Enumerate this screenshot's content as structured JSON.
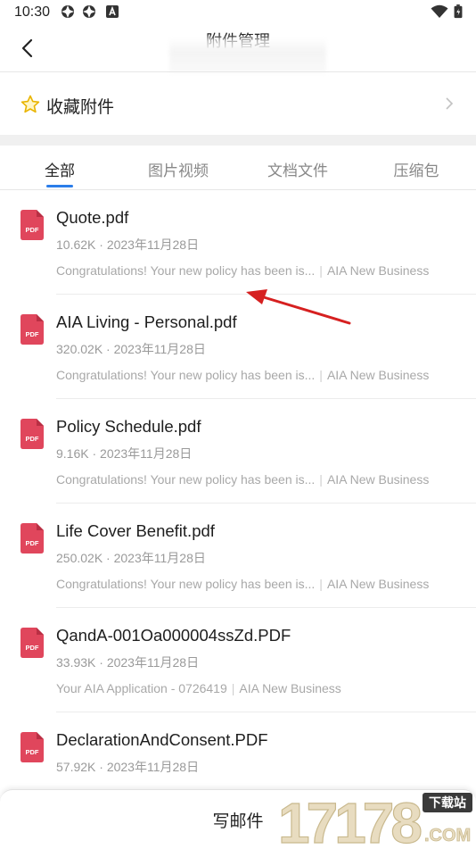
{
  "status_bar": {
    "time": "10:30"
  },
  "header": {
    "title": "附件管理"
  },
  "favorites": {
    "label": "收藏附件"
  },
  "tabs": [
    {
      "label": "全部"
    },
    {
      "label": "图片视频"
    },
    {
      "label": "文档文件"
    },
    {
      "label": "压缩包"
    }
  ],
  "files": [
    {
      "name": "Quote.pdf",
      "meta": "10.62K · 2023年11月28日",
      "subject": "Congratulations! Your new policy has been is...",
      "sender": "AIA New Business"
    },
    {
      "name": "AIA Living - Personal.pdf",
      "meta": "320.02K · 2023年11月28日",
      "subject": "Congratulations! Your new policy has been is...",
      "sender": "AIA New Business"
    },
    {
      "name": "Policy Schedule.pdf",
      "meta": "9.16K · 2023年11月28日",
      "subject": "Congratulations! Your new policy has been is...",
      "sender": "AIA New Business"
    },
    {
      "name": "Life Cover Benefit.pdf",
      "meta": "250.02K · 2023年11月28日",
      "subject": "Congratulations! Your new policy has been is...",
      "sender": "AIA New Business"
    },
    {
      "name": "QandA-001Oa000004ssZd.PDF",
      "meta": "33.93K · 2023年11月28日",
      "subject": "Your AIA Application - 0726419",
      "sender": "AIA New Business"
    },
    {
      "name": "DeclarationAndConsent.PDF",
      "meta": "57.92K · 2023年11月28日",
      "subject": "",
      "sender": ""
    }
  ],
  "icons": {
    "file": "pdf-icon",
    "file_badge": "PDF"
  },
  "bottom": {
    "compose_label": "写邮件"
  },
  "watermark": {
    "text": "17178",
    "badge": "下载站",
    "domain": ".COM"
  },
  "colors": {
    "accent": "#2b7de9",
    "pdf": "#e0465c",
    "annotation_arrow": "#d62020"
  }
}
